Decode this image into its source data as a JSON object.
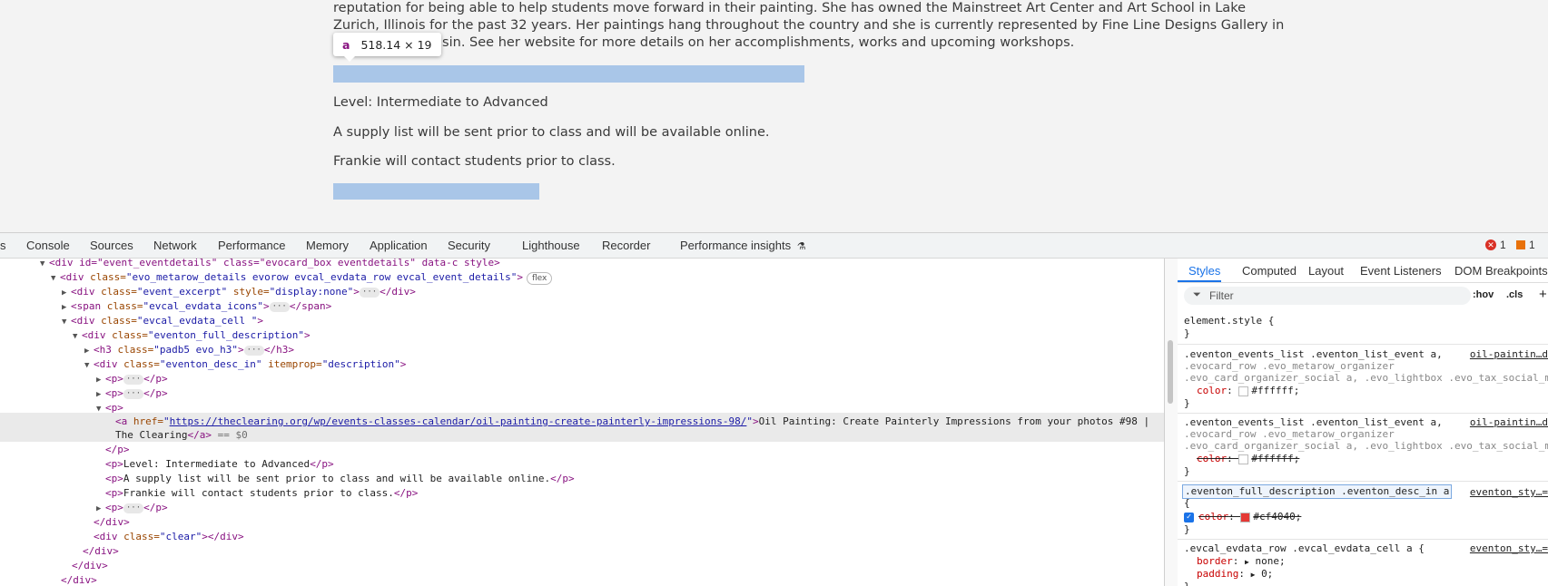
{
  "page": {
    "lines": [
      "reputation for being able to help students move forward in their painting. She has owned the Mainstreet Art Center and Art School in Lake",
      "Zurich, Illinois for the past 32 years. Her paintings hang throughout the country and she is currently represented by Fine Line Designs Gallery in",
      "onsin. See her website for more details on her accomplishments, works and upcoming workshops."
    ],
    "tooltip_tag": "a",
    "tooltip_size": "518.14 × 19",
    "level": "Level: Intermediate to Advanced",
    "supply": "A supply list will be sent prior to class and will be available online.",
    "contact": "Frankie will contact students prior to class."
  },
  "devtools": {
    "tabs": [
      "s",
      "Console",
      "Sources",
      "Network",
      "Performance",
      "Memory",
      "Application",
      "Security",
      "Lighthouse",
      "Recorder",
      "Performance insights"
    ],
    "errors": "1",
    "warnings": "1",
    "dom": {
      "l0": "<div id=\"event_eventdetails\" class=\"evocard_box eventdetails\" data-c style>",
      "l1_open": "<div",
      "l1_an": " class=",
      "l1_av": "\"evo_metarow_details evorow evcal_evdata_row evcal_event_details\"",
      "l1_close": ">",
      "l1_badge": "flex",
      "l2_open": "<div",
      "l2_an": " class=",
      "l2_av": "\"event_excerpt\"",
      "l2_an2": " style=",
      "l2_av2": "\"display:none\"",
      "l2_close": ">",
      "l2_end": "</div>",
      "l3_open": "<span",
      "l3_an": " class=",
      "l3_av": "\"evcal_evdata_icons\"",
      "l3_close": ">",
      "l3_end": "</span>",
      "l4_open": "<div",
      "l4_an": " class=",
      "l4_av": "\"evcal_evdata_cell \"",
      "l4_close": ">",
      "l5_open": "<div",
      "l5_an": " class=",
      "l5_av": "\"eventon_full_description\"",
      "l5_close": ">",
      "l6_open": "<h3",
      "l6_an": " class=",
      "l6_av": "\"padb5 evo_h3\"",
      "l6_close": ">",
      "l6_end": "</h3>",
      "l7_open": "<div",
      "l7_an": " class=",
      "l7_av": "\"eventon_desc_in\"",
      "l7_an2": " itemprop=",
      "l7_av2": "\"description\"",
      "l7_close": ">",
      "p_open": "<p>",
      "p_close": "</p>",
      "a_open": "<a",
      "a_an": " href=",
      "a_q": "\"",
      "a_href": "https://theclearing.org/wp/events-classes-calendar/oil-painting-create-painterly-impressions-98/",
      "a_gt": ">",
      "a_text1": "Oil Painting: Create Painterly Impressions from your photos #98 |",
      "a_text2": "The Clearing",
      "a_end": "</a>",
      "a_eq": " == $0",
      "level_text": "Level: Intermediate to Advanced",
      "supply_text": "A supply list will be sent prior to class and will be available online.",
      "contact_text": "Frankie will contact students prior to class.",
      "div_close": "</div>",
      "clear_open": "<div",
      "clear_an": " class=",
      "clear_av": "\"clear\"",
      "clear_close": "></div>"
    },
    "styles": {
      "tabs": [
        "Styles",
        "Computed",
        "Layout",
        "Event Listeners",
        "DOM Breakpoints"
      ],
      "filter_placeholder": "Filter",
      "hov": ":hov",
      "cls": ".cls",
      "plus": "+",
      "element_style": "element.style {",
      "close_brace": "}",
      "r1_sel1": ".eventon_events_list .eventon_list_event a,",
      "r1_sel2": ".evocard_row .evo_metarow_organizer",
      "r1_sel3": ".evo_card_organizer_social a, .evo_lightbox .evo_tax_social_m",
      "r1_src": "oil-paintin…d",
      "r1_prop": "color",
      "r1_val": "#ffffff;",
      "r2_src": "oil-paintin…d",
      "r3_sel": ".eventon_full_description .eventon_desc_in a",
      "r3_src": "eventon_sty…=",
      "r3_open": "{",
      "r3_prop": "color",
      "r3_val": "#cf4040;",
      "r4_sel": ".evcal_evdata_row .evcal_evdata_cell a {",
      "r4_src": "eventon_sty…=",
      "r4_p1": "border",
      "r4_v1": "none;",
      "r4_p2": "padding",
      "r4_v2": "0;"
    },
    "colors": {
      "red_swatch": "#e53935",
      "white_swatch": "#ffffff",
      "accent": "#1a73e8"
    }
  }
}
